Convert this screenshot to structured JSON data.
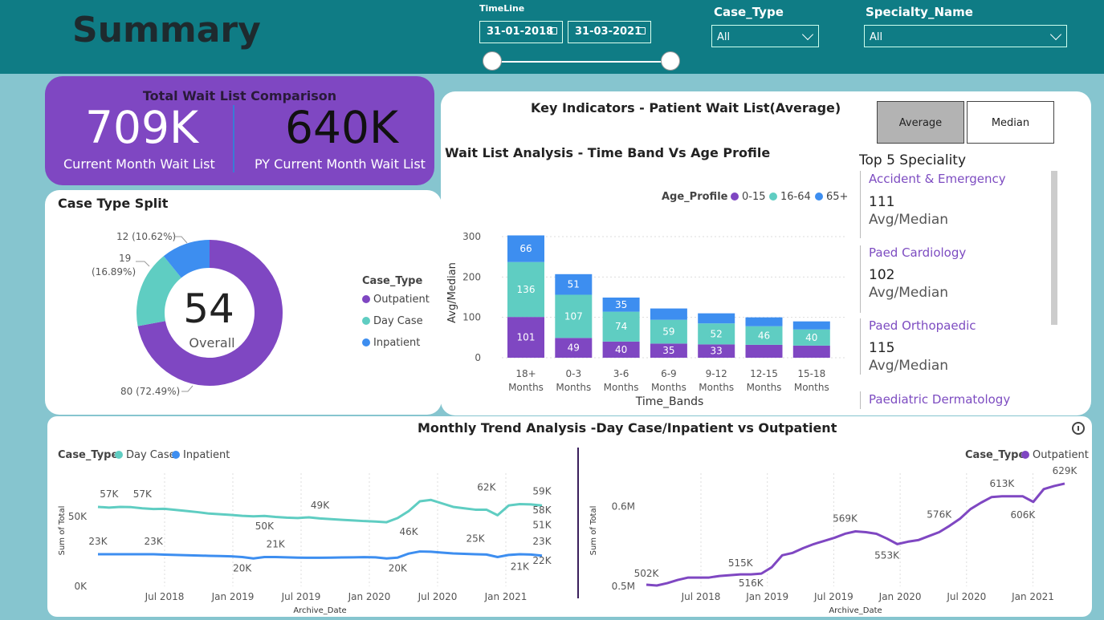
{
  "header": {
    "title": "Summary",
    "timeline_label": "TimeLine",
    "date_start": "31-01-2018",
    "date_end": "31-03-2021",
    "case_type_label": "Case_Type",
    "case_type_value": "All",
    "specialty_label": "Specialty_Name",
    "specialty_value": "All"
  },
  "kpi": {
    "title": "Total Wait List Comparison",
    "current_value": "709K",
    "current_label": "Current Month Wait List",
    "py_value": "640K",
    "py_label": "PY Current Month Wait List"
  },
  "case_split": {
    "title": "Case Type Split",
    "center_value": "54",
    "center_label": "Overall",
    "legend_title": "Case_Type",
    "slices": [
      {
        "name": "Outpatient",
        "value": 80,
        "label": "80 (72.49%)",
        "color": "#7f47c2"
      },
      {
        "name": "Day Case",
        "value": 19,
        "label1": "19",
        "label2": "(16.89%)",
        "color": "#5fcdc2"
      },
      {
        "name": "Inpatient",
        "value": 12,
        "label": "12 (10.62%)",
        "color": "#3d8ef0"
      }
    ]
  },
  "key_indicators": {
    "title": "Key Indicators - Patient Wait List(Average)",
    "btn_average": "Average",
    "btn_median": "Median"
  },
  "wait_chart": {
    "title": "Wait List Analysis - Time Band Vs Age Profile",
    "legend_title": "Age_Profile",
    "legend": [
      {
        "name": "0-15",
        "color": "#7f47c2"
      },
      {
        "name": "16-64",
        "color": "#5fcdc2"
      },
      {
        "name": "65+",
        "color": "#3d8ef0"
      }
    ],
    "ylabel": "Avg/Median",
    "xlabel": "Time_Bands"
  },
  "top5": {
    "title": "Top 5 Speciality",
    "items": [
      {
        "name": "Accident & Emergency",
        "value": "111",
        "sub": "Avg/Median"
      },
      {
        "name": "Paed Cardiology",
        "value": "102",
        "sub": "Avg/Median"
      },
      {
        "name": "Paed Orthopaedic",
        "value": "115",
        "sub": "Avg/Median"
      },
      {
        "name": "Paediatric Dermatology"
      }
    ]
  },
  "trend": {
    "title": "Monthly Trend Analysis -Day Case/Inpatient vs Outpatient",
    "left_legend_title": "Case_Type",
    "left_legend": [
      {
        "name": "Day Case",
        "color": "#5fcdc2"
      },
      {
        "name": "Inpatient",
        "color": "#3d8ef0"
      }
    ],
    "right_legend_title": "Case_Type",
    "right_legend": [
      {
        "name": "Outpatient",
        "color": "#7f47c2"
      }
    ]
  },
  "chart_data": [
    {
      "type": "bar",
      "stacked": true,
      "title": "Wait List Analysis - Time Band Vs Age Profile",
      "xlabel": "Time_Bands",
      "ylabel": "Avg/Median",
      "categories": [
        "18+ Months",
        "0-3 Months",
        "3-6 Months",
        "6-9 Months",
        "9-12 Months",
        "12-15 Months",
        "15-18 Months"
      ],
      "ylim": [
        0,
        300
      ],
      "yticks": [
        0,
        100,
        200,
        300
      ],
      "series": [
        {
          "name": "0-15",
          "color": "#7f47c2",
          "values": [
            101,
            49,
            40,
            35,
            33,
            32,
            30
          ],
          "labels": [
            "101",
            "49",
            "40",
            "35",
            "33",
            "",
            ""
          ]
        },
        {
          "name": "16-64",
          "color": "#5fcdc2",
          "values": [
            136,
            107,
            74,
            59,
            52,
            46,
            40
          ],
          "labels": [
            "136",
            "107",
            "74",
            "59",
            "52",
            "46",
            "40"
          ]
        },
        {
          "name": "65+",
          "color": "#3d8ef0",
          "values": [
            66,
            51,
            35,
            28,
            25,
            22,
            20
          ],
          "labels": [
            "66",
            "51",
            "35",
            "",
            "",
            "",
            ""
          ]
        }
      ],
      "legend": "top-right",
      "grid": true
    },
    {
      "type": "line",
      "title": "",
      "xlabel": "Archive_Date",
      "ylabel": "Sum of Total",
      "x": [
        "2018-01",
        "2018-02",
        "2018-03",
        "2018-04",
        "2018-05",
        "2018-06",
        "2018-07",
        "2018-08",
        "2018-09",
        "2018-10",
        "2018-11",
        "2018-12",
        "2019-01",
        "2019-02",
        "2019-03",
        "2019-04",
        "2019-05",
        "2019-06",
        "2019-07",
        "2019-08",
        "2019-09",
        "2019-10",
        "2019-11",
        "2019-12",
        "2020-01",
        "2020-02",
        "2020-03",
        "2020-04",
        "2020-05",
        "2020-06",
        "2020-07",
        "2020-08",
        "2020-09",
        "2020-10",
        "2020-11",
        "2020-12",
        "2021-01",
        "2021-02",
        "2021-03"
      ],
      "xticks": [
        "Jul 2018",
        "Jan 2019",
        "Jul 2019",
        "Jan 2020",
        "Jul 2020",
        "Jan 2021"
      ],
      "yticks": [
        "0K",
        "50K"
      ],
      "ylim": [
        0,
        80
      ],
      "series": [
        {
          "name": "Day Case",
          "color": "#5fcdc2",
          "values": [
            57,
            56.5,
            57,
            56.8,
            56,
            55.5,
            55.6,
            54.8,
            54,
            53.2,
            52.2,
            51.7,
            51.2,
            50.6,
            50.2,
            50.5,
            49.8,
            49.3,
            49,
            49.5,
            48.7,
            48.2,
            47.7,
            47.3,
            46.8,
            46.5,
            46,
            49,
            54,
            61,
            62,
            59.5,
            57,
            56,
            55,
            55,
            51,
            58,
            59,
            58.8,
            58
          ]
        },
        {
          "name": "Inpatient",
          "color": "#3d8ef0",
          "values": [
            23,
            23,
            23,
            23,
            23,
            23,
            22.7,
            22.5,
            22.3,
            22.1,
            21.9,
            21.7,
            21.5,
            21,
            20,
            21,
            21,
            20.8,
            20.6,
            20.5,
            20.5,
            20.6,
            20.7,
            20.8,
            20.9,
            20.8,
            20,
            20.6,
            23.5,
            25,
            24.8,
            24.2,
            23.6,
            23.3,
            23,
            22.8,
            21,
            22.5,
            23,
            22.8,
            22
          ]
        }
      ],
      "labels": [
        "57K",
        "57K",
        "50K",
        "49K",
        "46K",
        "62K",
        "51K",
        "59K",
        "58K",
        "23K",
        "23K",
        "20K",
        "21K",
        "20K",
        "25K",
        "21K",
        "23K",
        "22K"
      ]
    },
    {
      "type": "line",
      "title": "",
      "xlabel": "Archive_Date",
      "ylabel": "Sum of Total",
      "xticks": [
        "Jul 2018",
        "Jan 2019",
        "Jul 2019",
        "Jan 2020",
        "Jul 2020",
        "Jan 2021"
      ],
      "yticks": [
        "0.5M",
        "0.6M"
      ],
      "ylim": [
        0.5,
        0.64
      ],
      "series": [
        {
          "name": "Outpatient",
          "color": "#7f47c2",
          "values": [
            502,
            501,
            504,
            508,
            511,
            511,
            511,
            513,
            514,
            515,
            515,
            516,
            524,
            539,
            542,
            548,
            553,
            557,
            561,
            566,
            569,
            568,
            566,
            560,
            553,
            556,
            558,
            563,
            568,
            576,
            585,
            597,
            605,
            612,
            613,
            613,
            613,
            606,
            622,
            626,
            629
          ]
        }
      ],
      "labels": [
        "502K",
        "515K",
        "516K",
        "569K",
        "553K",
        "576K",
        "613K",
        "606K",
        "629K"
      ]
    }
  ]
}
